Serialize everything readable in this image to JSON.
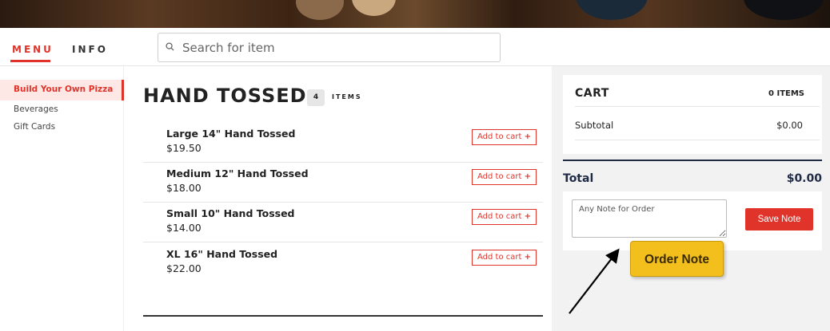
{
  "nav": {
    "tabs": [
      {
        "label": "MENU"
      },
      {
        "label": "INFO"
      }
    ]
  },
  "search": {
    "placeholder": "Search for item"
  },
  "sidebar": {
    "items": [
      {
        "label": "Build Your Own Pizza"
      },
      {
        "label": "Beverages"
      },
      {
        "label": "Gift Cards"
      }
    ]
  },
  "section": {
    "title": "HAND TOSSED",
    "count": "4",
    "count_label": "ITEMS",
    "items": [
      {
        "name": "Large 14\" Hand Tossed",
        "price": "$19.50",
        "button": "Add to cart"
      },
      {
        "name": "Medium 12\" Hand Tossed",
        "price": "$18.00",
        "button": "Add to cart"
      },
      {
        "name": "Small 10\" Hand Tossed",
        "price": "$14.00",
        "button": "Add to cart"
      },
      {
        "name": "XL 16\" Hand Tossed",
        "price": "$22.00",
        "button": "Add to cart"
      }
    ],
    "add_icon": "+"
  },
  "cart": {
    "title": "CART",
    "count": "0 ITEMS",
    "subtotal_label": "Subtotal",
    "subtotal_value": "$0.00",
    "total_label": "Total",
    "total_value": "$0.00",
    "note_placeholder": "Any Note for Order",
    "save_label": "Save Note"
  },
  "annotation": {
    "label": "Order Note"
  },
  "colors": {
    "accent": "#e0342b",
    "callout": "#f3bf1d",
    "total": "#1f2a44"
  }
}
